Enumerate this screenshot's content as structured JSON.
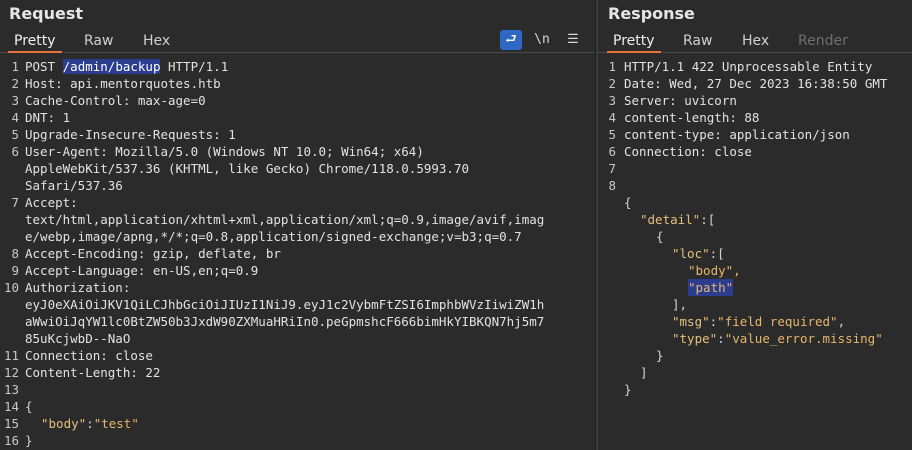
{
  "request": {
    "title": "Request",
    "tabs": [
      "Pretty",
      "Raw",
      "Hex"
    ],
    "tools": {
      "wrap": "⮐",
      "newline": "\\n",
      "menu": "☰"
    },
    "lines": {
      "l1_a": "POST ",
      "l1_path": "/admin/backup",
      "l1_b": " HTTP/1.1",
      "l2": "Host: api.mentorquotes.htb",
      "l3": "Cache-Control: max-age=0",
      "l4": "DNT: 1",
      "l5": "Upgrade-Insecure-Requests: 1",
      "l6a": "User-Agent: Mozilla/5.0 (Windows NT 10.0; Win64; x64)",
      "l6b": "AppleWebKit/537.36 (KHTML, like Gecko) Chrome/118.0.5993.70",
      "l6c": "Safari/537.36",
      "l7a": "Accept:",
      "l7b": "text/html,application/xhtml+xml,application/xml;q=0.9,image/avif,imag",
      "l7c": "e/webp,image/apng,*/*;q=0.8,application/signed-exchange;v=b3;q=0.7",
      "l8": "Accept-Encoding: gzip, deflate, br",
      "l9": "Accept-Language: en-US,en;q=0.9",
      "l10a": "Authorization:",
      "l10b": "eyJ0eXAiOiJKV1QiLCJhbGciOiJIUzI1NiJ9.eyJ1c2VybmFtZSI6ImphbWVzIiwiZW1h",
      "l10c": "aWwiOiJqYW1lc0BtZW50b3JxdW90ZXMuaHRiIn0.peGpmshcF666bimHkYIBKQN7hj5m7",
      "l10d": "85uKcjwbD--NaO",
      "l11": "Connection: close",
      "l12": "Content-Length: 22",
      "l14": "{",
      "l15_key": "\"body\"",
      "l15_colon": ":",
      "l15_val": "\"test\"",
      "l16": "}"
    }
  },
  "response": {
    "title": "Response",
    "tabs": [
      "Pretty",
      "Raw",
      "Hex",
      "Render"
    ],
    "lines": {
      "l1": "HTTP/1.1 422 Unprocessable Entity",
      "l2": "Date: Wed, 27 Dec 2023 16:38:50 GMT",
      "l3": "Server: uvicorn",
      "l4": "content-length: 88",
      "l5": "content-type: application/json",
      "l6": "Connection: close",
      "j1": "{",
      "j2_key": "\"detail\"",
      "j2_rest": ":[",
      "j3": "{",
      "j4_key": "\"loc\"",
      "j4_rest": ":[",
      "j5": "\"body\",",
      "j6": "\"path\"",
      "j7": "],",
      "j8_key": "\"msg\"",
      "j8_colon": ":",
      "j8_val": "\"field required\"",
      "j8_comma": ",",
      "j9_key": "\"type\"",
      "j9_colon": ":",
      "j9_val": "\"value_error.missing\"",
      "j10": "}",
      "j11": "]",
      "j12": "}"
    }
  },
  "line_numbers": [
    "1",
    "2",
    "3",
    "4",
    "5",
    "6",
    "7",
    "8",
    "9",
    "10",
    "11",
    "12",
    "13",
    "14",
    "15",
    "16"
  ],
  "colors": {
    "accent": "#e8743b",
    "highlight": "#2b3d8f",
    "key": "#e5c07b",
    "background": "#2b2b2b"
  }
}
